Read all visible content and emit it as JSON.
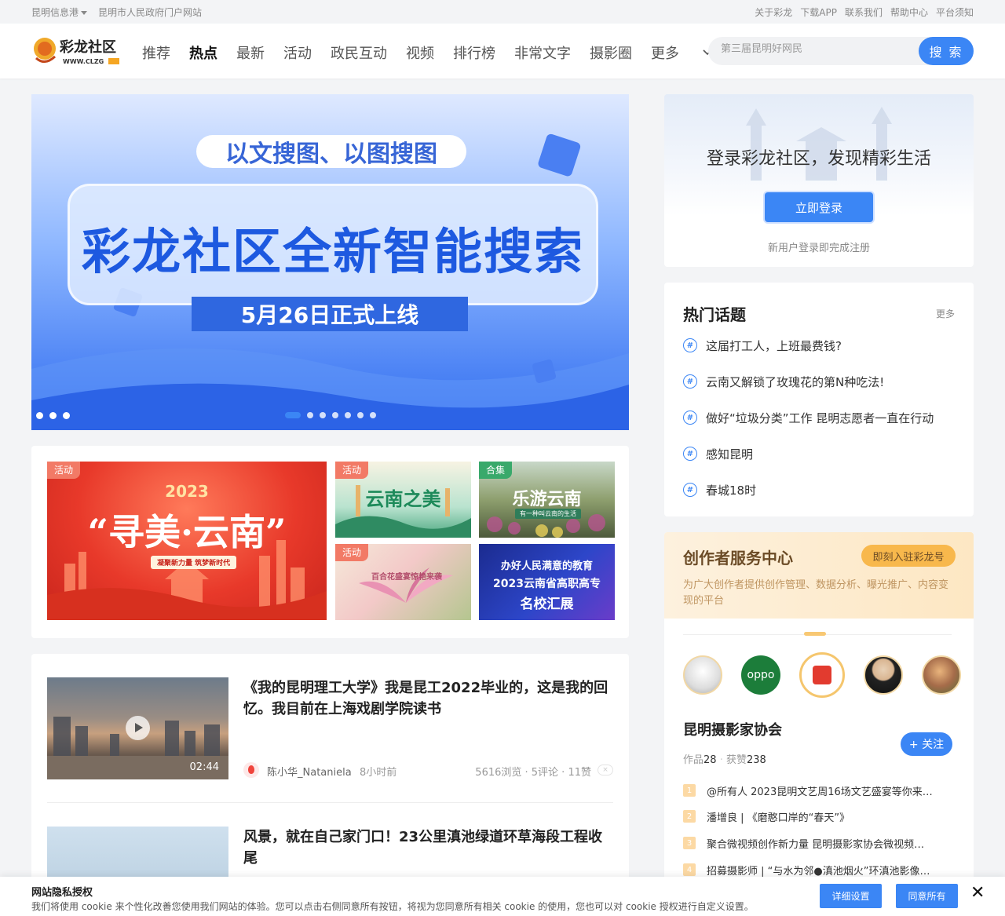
{
  "topbar": {
    "left": [
      "昆明信息港",
      "昆明市人民政府门户网站"
    ],
    "right": [
      "关于彩龙",
      "下载APP",
      "联系我们",
      "帮助中心",
      "平台须知"
    ]
  },
  "header": {
    "logo_text": "彩龙社区",
    "logo_url_text": "WWW.CLZG",
    "nav": [
      "推荐",
      "热点",
      "最新",
      "活动",
      "政民互动",
      "视频",
      "排行榜",
      "非常文字",
      "摄影圈"
    ],
    "nav_active": "热点",
    "more_label": "更多",
    "search_placeholder": "第三届昆明好网民",
    "search_button": "搜 索"
  },
  "banner": {
    "pill": "以文搜图、以图搜图",
    "headline": "彩龙社区全新智能搜索",
    "date": "5月26日正式上线",
    "slide_count": 7,
    "active_slide": 1
  },
  "promo": {
    "tiles": [
      {
        "tag": "活动",
        "line1": "2023",
        "line2": "“寻美·云南”",
        "line3": "凝聚新力量 筑梦新时代"
      },
      {
        "tag": "活动",
        "line1": "云南之美"
      },
      {
        "tag": "合集",
        "line1": "乐游云南",
        "line2": "有一种叫云南的生活"
      },
      {
        "tag": "活动",
        "line1": "百合花盛宴惊艳来袭"
      },
      {
        "tag": "",
        "line1": "办好人民满意的教育",
        "line2": "2023云南省高职高专",
        "line3": "名校汇展"
      }
    ]
  },
  "feed": [
    {
      "title": "《我的昆明理工大学》我是昆工2022毕业的，这是我的回忆。我目前在上海戏剧学院读书",
      "duration": "02:44",
      "author": "陈小华_Nataniela",
      "time": "8小时前",
      "stats": "5616浏览 · 5评论 · 11赞",
      "close": "×"
    },
    {
      "title": "风景，就在自己家门口！23公里滇池绿道环草海段工程收尾"
    }
  ],
  "login_card": {
    "heading": "登录彩龙社区，发现精彩生活",
    "button": "立即登录",
    "note": "新用户登录即完成注册"
  },
  "hot_topics": {
    "heading": "热门话题",
    "more": "更多",
    "items": [
      "这届打工人，上班最费钱?",
      "云南又解锁了玫瑰花的第N种吃法!",
      "做好“垃圾分类”工作 昆明志愿者一直在行动",
      "感知昆明",
      "春城18时"
    ]
  },
  "creator": {
    "heading": "创作者服务中心",
    "join": "即刻入驻彩龙号",
    "desc": "为广大创作者提供创作管理、数据分析、曝光推广、内容变现的平台",
    "avatar_oppo": "oppo",
    "name": "昆明摄影家协会",
    "follow": "+ 关注",
    "works_label": "作品",
    "works": "28",
    "likes_label": "获赞",
    "likes": "238",
    "list": [
      {
        "n": "1",
        "t": "@所有人 2023昆明文艺周16场文艺盛宴等你来…"
      },
      {
        "n": "2",
        "t": "潘增良 | 《磨憨口岸的“春天”》"
      },
      {
        "n": "3",
        "t": "聚合微视频创作新力量 昆明摄影家协会微视频…"
      },
      {
        "n": "4",
        "t": "招募摄影师 | “与水为邻●滇池烟火”环滇池影像…"
      }
    ]
  },
  "cookie": {
    "heading": "网站隐私授权",
    "desc": "我们将使用 cookie 来个性化改善您使用我们网站的体验。您可以点击右侧同意所有按钮，将视为您同意所有相关 cookie 的使用，您也可以对 cookie 授权进行自定义设置。",
    "settings": "详细设置",
    "accept": "同意所有",
    "close": "✕"
  },
  "colors": {
    "accent": "#3b86f5",
    "creator_bg": "#fdf1de",
    "tag_red": "#f27a66",
    "tag_green": "#39a96b"
  }
}
